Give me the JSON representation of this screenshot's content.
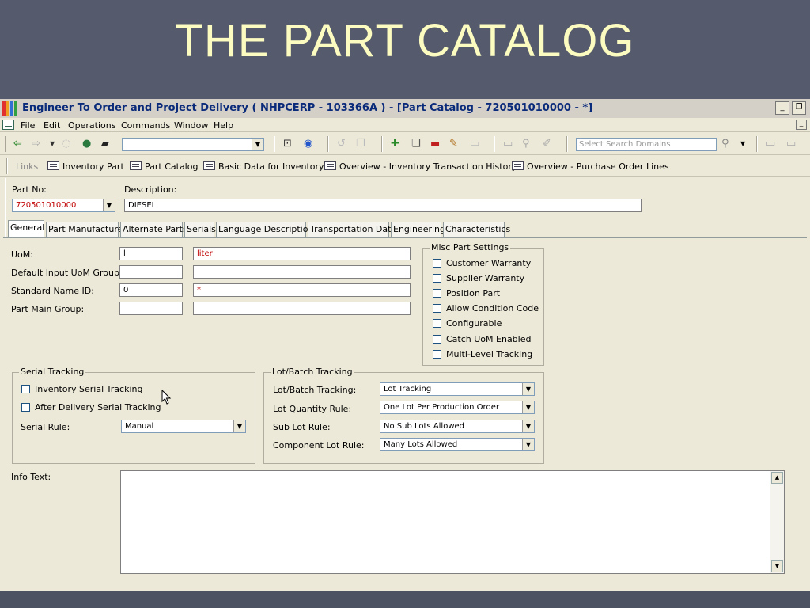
{
  "slide": {
    "title": "THE PART CATALOG"
  },
  "window": {
    "title": "Engineer To Order and Project Delivery ( NHPCERP - 103366A ) - [Part Catalog - 720501010000 - *]",
    "min_glyph": "_",
    "restore_glyph": "❐"
  },
  "menubar": {
    "items": [
      "File",
      "Edit",
      "Operations",
      "Commands",
      "Window",
      "Help"
    ],
    "mdi_min": "_"
  },
  "toolbar": {
    "search_placeholder": "Select Search Domains",
    "nav_combo_value": "",
    "icons": [
      "back-icon",
      "forward-icon",
      "refresh-icon",
      "populate-icon",
      "car-icon",
      "prev-record-icon",
      "help-icon",
      "undo-icon",
      "copy-icon",
      "new-icon",
      "duplicate-icon",
      "delete-icon",
      "clear-icon",
      "save-icon",
      "print-icon",
      "zoom-icon",
      "edit-icon",
      "search-icon",
      "expand-icon",
      "collapse-icon"
    ]
  },
  "links": {
    "label": "Links",
    "items": [
      "Inventory Part",
      "Part Catalog",
      "Basic Data for Inventory",
      "Overview - Inventory Transaction History",
      "Overview - Purchase Order Lines"
    ]
  },
  "header": {
    "part_no_label": "Part No:",
    "part_no_value": "720501010000",
    "description_label": "Description:",
    "description_value": "DIESEL"
  },
  "tabs": [
    "General",
    "Part Manufacturer",
    "Alternate Parts",
    "Serials",
    "Language Description",
    "Transportation Data",
    "Engineering",
    "Characteristics"
  ],
  "general": {
    "uom_label": "UoM:",
    "uom_code": "l",
    "uom_desc": "liter",
    "default_input_uom_label": "Default Input UoM Group:",
    "default_input_uom_value": "",
    "default_input_uom_desc": "",
    "standard_name_label": "Standard Name ID:",
    "standard_name_value": "0",
    "standard_name_desc": "*",
    "part_main_group_label": "Part Main Group:",
    "part_main_group_value": "",
    "part_main_group_desc": ""
  },
  "misc": {
    "title": "Misc Part Settings",
    "items": [
      "Customer Warranty",
      "Supplier Warranty",
      "Position Part",
      "Allow Condition Code",
      "Configurable",
      "Catch UoM Enabled",
      "Multi-Level Tracking"
    ]
  },
  "serial_tracking": {
    "title": "Serial Tracking",
    "inventory_serial": "Inventory Serial Tracking",
    "after_delivery_serial": "After Delivery Serial Tracking",
    "serial_rule_label": "Serial Rule:",
    "serial_rule_value": "Manual"
  },
  "lot_batch": {
    "title": "Lot/Batch Tracking",
    "tracking_label": "Lot/Batch Tracking:",
    "tracking_value": "Lot Tracking",
    "quantity_rule_label": "Lot Quantity Rule:",
    "quantity_rule_value": "One Lot Per Production Order",
    "sub_lot_label": "Sub Lot Rule:",
    "sub_lot_value": "No Sub Lots Allowed",
    "component_lot_label": "Component Lot Rule:",
    "component_lot_value": "Many Lots Allowed"
  },
  "info_text": {
    "label": "Info Text:",
    "value": ""
  },
  "colors": {
    "title_text": "#fdfcc0",
    "slide_bg": "#555a6c",
    "window_bg": "#ece9d8",
    "title_blue": "#0a2a7a",
    "error_red": "#c00000"
  }
}
